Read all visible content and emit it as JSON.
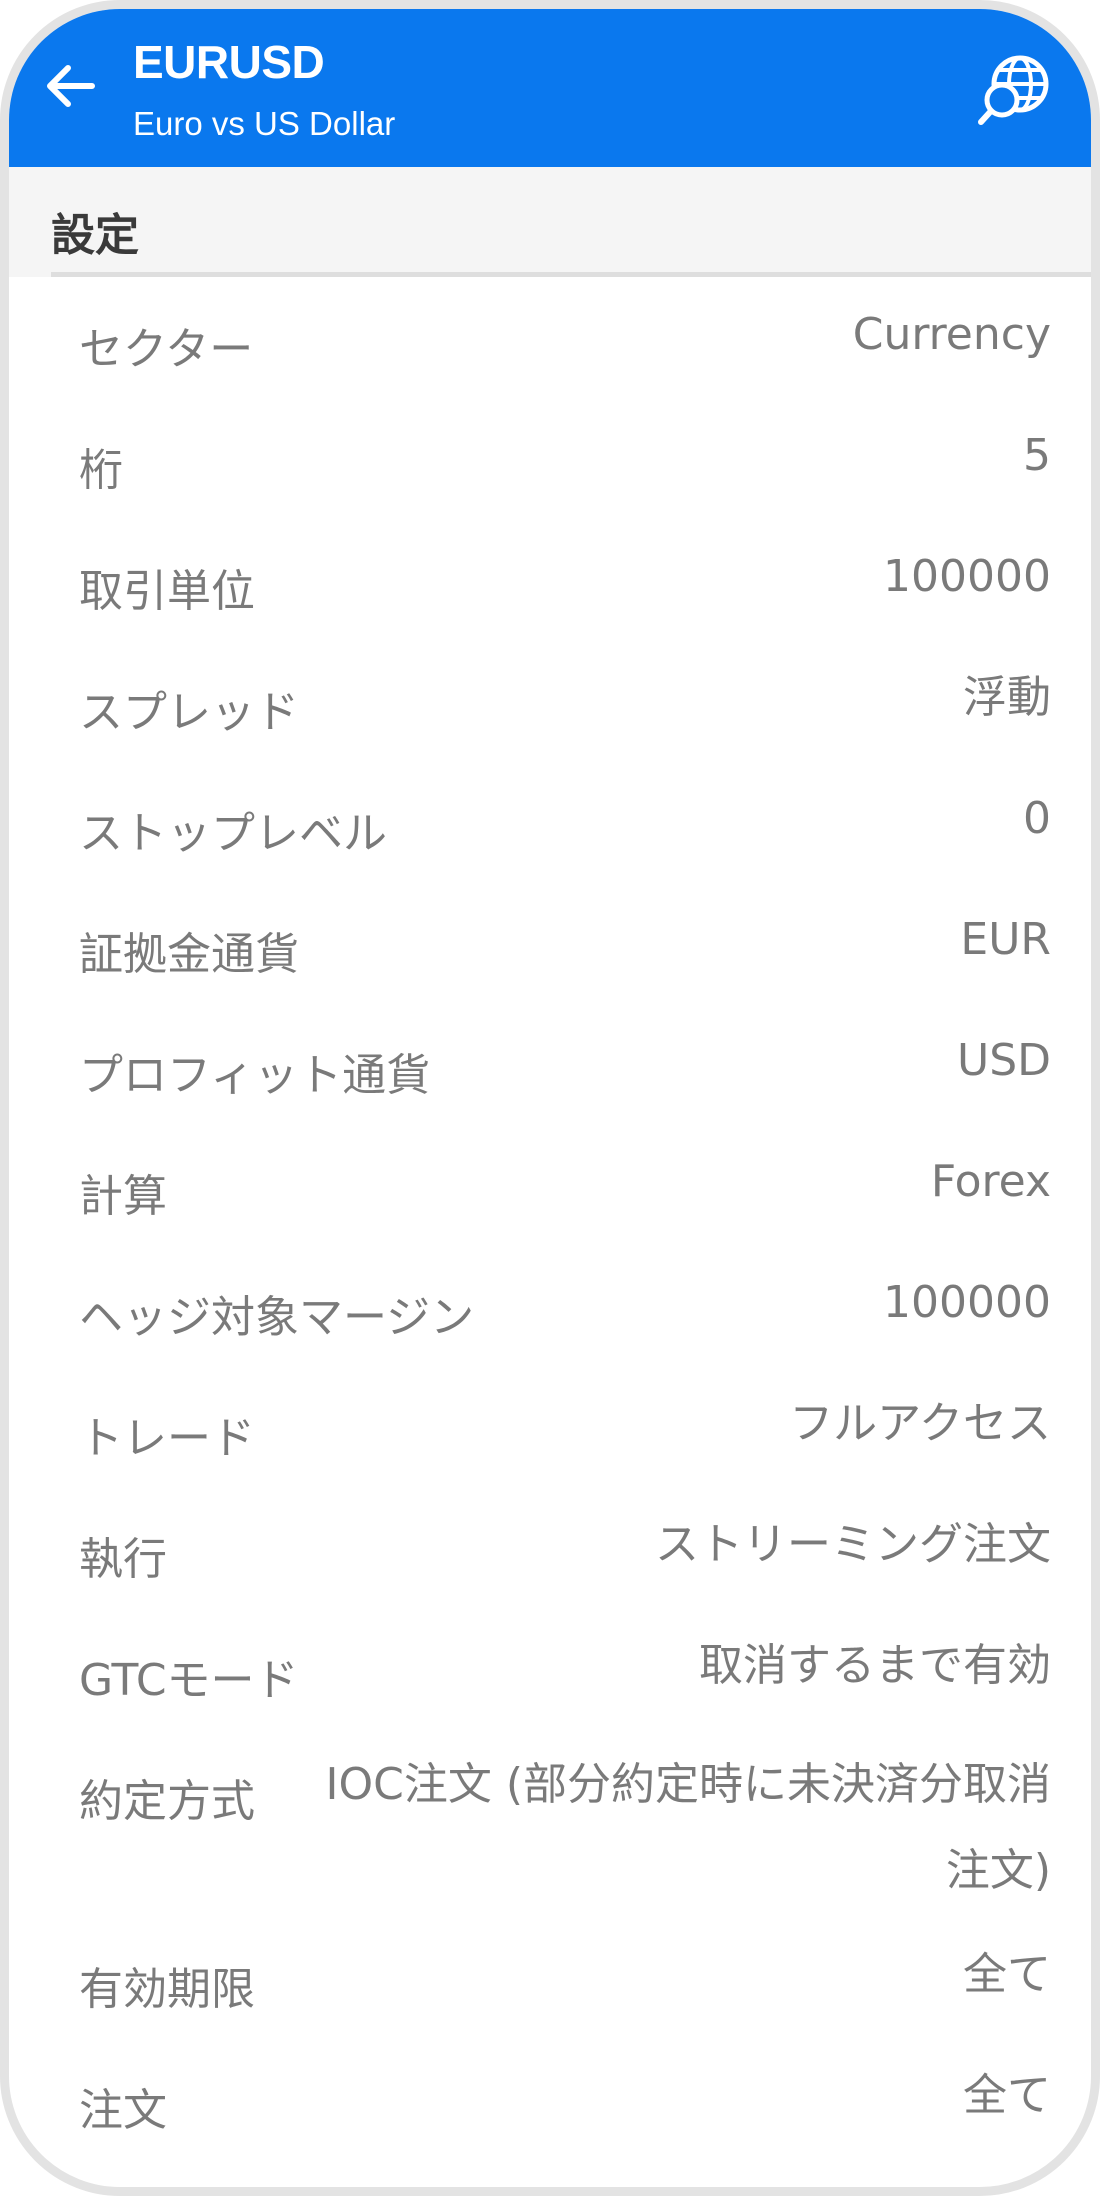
{
  "header": {
    "title": "EURUSD",
    "subtitle": "Euro vs US Dollar",
    "back_icon": "arrow-left-icon",
    "globe_icon": "globe-search-icon",
    "background": "#0a78ee"
  },
  "section": {
    "title": "設定"
  },
  "rows": [
    {
      "label": "セクター",
      "value": "Currency"
    },
    {
      "label": "桁",
      "value": "5"
    },
    {
      "label": "取引単位",
      "value": "100000"
    },
    {
      "label": "スプレッド",
      "value": "浮動"
    },
    {
      "label": "ストップレベル",
      "value": "0"
    },
    {
      "label": "証拠金通貨",
      "value": "EUR"
    },
    {
      "label": "プロフィット通貨",
      "value": "USD"
    },
    {
      "label": "計算",
      "value": "Forex"
    },
    {
      "label": "ヘッジ対象マージン",
      "value": "100000"
    },
    {
      "label": "トレード",
      "value": "フルアクセス"
    },
    {
      "label": "執行",
      "value": "ストリーミング注文"
    },
    {
      "label": "GTCモード",
      "value": "取消するまで有効"
    },
    {
      "label": "約定方式",
      "value": "IOC注文 (部分約定時に未決済分取消注文)"
    },
    {
      "label": "有効期限",
      "value": "全て"
    },
    {
      "label": "注文",
      "value": "全て"
    }
  ]
}
